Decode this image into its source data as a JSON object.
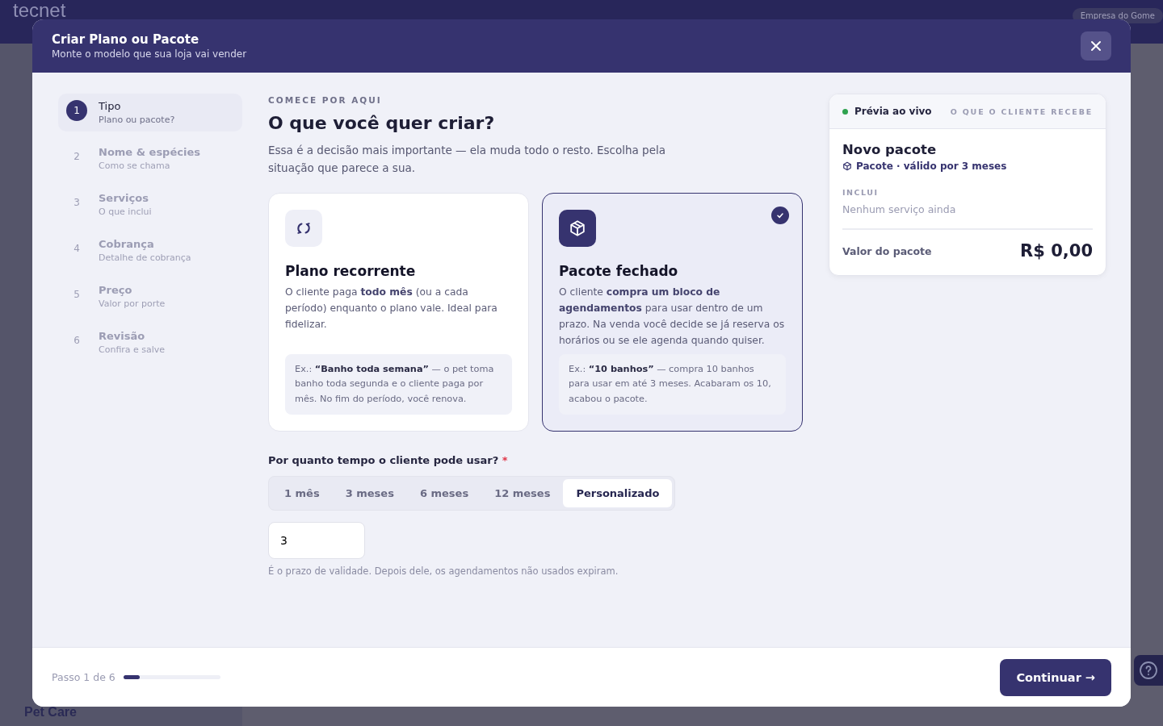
{
  "background": {
    "logo": "tecnet",
    "company": "Empresa do Gome",
    "sidebar_label": "Pet Care"
  },
  "modal": {
    "title": "Criar Plano ou Pacote",
    "subtitle": "Monte o modelo que sua loja vai vender"
  },
  "steps": [
    {
      "number": "1",
      "title": "Tipo",
      "subtitle": "Plano ou pacote?",
      "selected": true
    },
    {
      "number": "2",
      "title": "Nome & espécies",
      "subtitle": "Como se chama",
      "selected": false
    },
    {
      "number": "3",
      "title": "Serviços",
      "subtitle": "O que inclui",
      "selected": false
    },
    {
      "number": "4",
      "title": "Cobrança",
      "subtitle": "Detalhe de cobrança",
      "selected": false
    },
    {
      "number": "5",
      "title": "Preço",
      "subtitle": "Valor por porte",
      "selected": false
    },
    {
      "number": "6",
      "title": "Revisão",
      "subtitle": "Confira e salve",
      "selected": false
    }
  ],
  "eyebrow": "COMECE POR AQUI",
  "heading": "O que você quer criar?",
  "intro": "Essa é a decisão mais importante — ela muda todo o resto. Escolha pela situação que parece a sua.",
  "options": [
    {
      "kind": "recurring",
      "title": "Plano recorrente",
      "description": "O cliente paga **todo mês** (ou a cada período) enquanto o plano vale. Ideal para fidelizar.",
      "example": "Ex.: **“Banho toda semana”** — o pet toma banho toda segunda e o cliente paga por mês. No fim do período, você renova.",
      "selected": false
    },
    {
      "kind": "package",
      "title": "Pacote fechado",
      "description": "O cliente **compra um bloco de agendamentos** para usar dentro de um prazo. Na venda você decide se já reserva os horários ou se ele agenda quando quiser.",
      "example": "Ex.: **“10 banhos”** — compra 10 banhos para usar em até 3 meses. Acabaram os 10, acabou o pacote.",
      "selected": true
    }
  ],
  "duration": {
    "label": "Por quanto tempo o cliente pode usar?",
    "required_mark": "*",
    "options": [
      {
        "label": "1 mês",
        "selected": false
      },
      {
        "label": "3 meses",
        "selected": false
      },
      {
        "label": "6 meses",
        "selected": false
      },
      {
        "label": "12 meses",
        "selected": false
      },
      {
        "label": "Personalizado",
        "selected": true
      }
    ],
    "value": "3",
    "hint": "É o prazo de validade. Depois dele, os agendamentos não usados expiram."
  },
  "preview": {
    "live_label": "Prévia ao vivo",
    "caption": "O QUE O CLIENTE RECEBE",
    "name": "Novo pacote",
    "type_line": "Pacote · válido por 3 meses",
    "includes_label": "INCLUI",
    "includes_empty": "Nenhum serviço ainda",
    "price_label": "Valor do pacote",
    "price": "R$ 0,00"
  },
  "footer": {
    "step_text": "Passo 1 de 6",
    "level": 0.1667,
    "continue": "Continuar →"
  }
}
